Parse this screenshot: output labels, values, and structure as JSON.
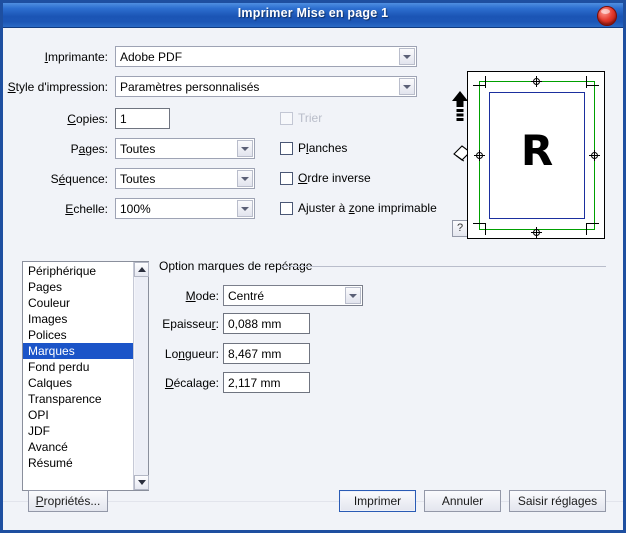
{
  "window": {
    "title": "Imprimer Mise en page 1",
    "close_icon": "close-icon",
    "accent_color": "#1b55b5",
    "background_color": "#f1f3f8"
  },
  "form": {
    "printer": {
      "label": "Imprimante:",
      "value": "Adobe PDF"
    },
    "print_style": {
      "label": "Style d'impression:",
      "value": "Paramètres personnalisés"
    },
    "copies": {
      "label": "Copies:",
      "value": "1"
    },
    "pages": {
      "label": "Pages:",
      "value": "Toutes"
    },
    "sequence": {
      "label": "Séquence:",
      "value": "Toutes"
    },
    "scale": {
      "label": "Echelle:",
      "value": "100%"
    },
    "checkboxes": [
      {
        "label": "Trier",
        "checked": false,
        "disabled": true
      },
      {
        "label": "Planches",
        "checked": false,
        "disabled": false
      },
      {
        "label": "Ordre inverse",
        "checked": false,
        "disabled": false
      },
      {
        "label": "Ajuster à zone imprimable",
        "checked": false,
        "disabled": false
      }
    ]
  },
  "preview": {
    "page_letter": "R",
    "bleed_color": "#00a000",
    "frame_color": "#1b2f9e",
    "orientation_portrait_icon": "arrow-up-icon",
    "orientation_rotate_icon": "rhombus-page-icon",
    "help_label": "?"
  },
  "sidebar": {
    "items": [
      "Périphérique",
      "Pages",
      "Couleur",
      "Images",
      "Polices",
      "Marques",
      "Fond perdu",
      "Calques",
      "Transparence",
      "OPI",
      "JDF",
      "Avancé",
      "Résumé"
    ],
    "selected": "Marques",
    "selected_color": "#1b54c8",
    "scroll_up_icon": "triangle-up-icon",
    "scroll_down_icon": "triangle-down-icon"
  },
  "marks_panel": {
    "group_title": "Option marques de repérage",
    "mode": {
      "label": "Mode:",
      "value": "Centré"
    },
    "thickness": {
      "label": "Epaisseur:",
      "value": "0,088 mm"
    },
    "length": {
      "label": "Longueur:",
      "value": "8,467 mm"
    },
    "offset": {
      "label": "Décalage:",
      "value": "2,117 mm"
    }
  },
  "footer": {
    "properties": "Propriétés...",
    "print": "Imprimer",
    "cancel": "Annuler",
    "save_settings": "Saisir réglages"
  }
}
